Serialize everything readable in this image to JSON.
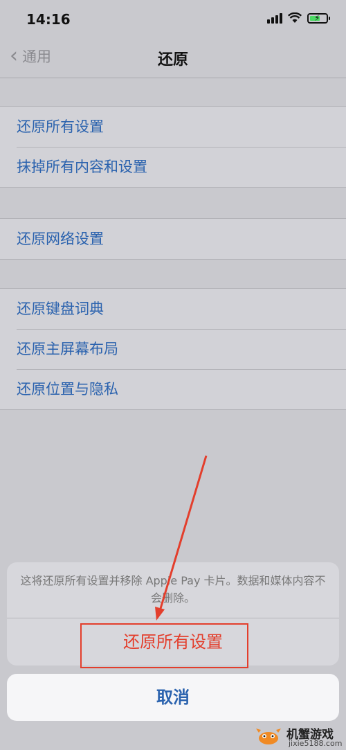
{
  "status": {
    "time": "14:16"
  },
  "nav": {
    "back_label": "通用",
    "title": "还原"
  },
  "groups": [
    {
      "items": [
        {
          "label": "还原所有设置"
        },
        {
          "label": "抹掉所有内容和设置"
        }
      ]
    },
    {
      "items": [
        {
          "label": "还原网络设置"
        }
      ]
    },
    {
      "items": [
        {
          "label": "还原键盘词典"
        },
        {
          "label": "还原主屏幕布局"
        },
        {
          "label": "还原位置与隐私"
        }
      ]
    }
  ],
  "sheet": {
    "message": "这将还原所有设置并移除 Apple Pay 卡片。数据和媒体内容不会删除。",
    "action_label": "还原所有设置",
    "cancel_label": "取消"
  },
  "watermark": {
    "title": "机蟹游戏",
    "url": "jixie5188.com"
  },
  "colors": {
    "link": "#2a62ae",
    "destructive": "#e33e2c",
    "annotation": "#e33e2c",
    "battery": "#4cd964"
  }
}
